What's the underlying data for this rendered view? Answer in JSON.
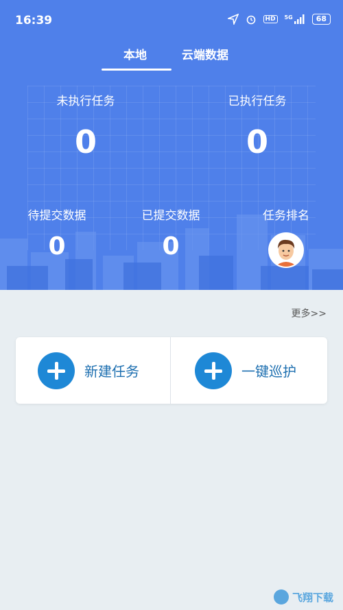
{
  "status_bar": {
    "time": "16:39",
    "battery": "68",
    "signal_label": "5G",
    "hd_label": "HD"
  },
  "tabs": [
    {
      "label": "本地",
      "active": true
    },
    {
      "label": "云端数据",
      "active": false
    }
  ],
  "stats": {
    "unexecuted": {
      "label": "未执行任务",
      "value": "0"
    },
    "executed": {
      "label": "已执行任务",
      "value": "0"
    },
    "pending_submit": {
      "label": "待提交数据",
      "value": "0"
    },
    "submitted": {
      "label": "已提交数据",
      "value": "0"
    },
    "ranking": {
      "label": "任务排名"
    }
  },
  "more_link": "更多>>",
  "actions": {
    "new_task": "新建任务",
    "one_click_patrol": "一键巡护"
  },
  "watermark": "飞翔下载",
  "colors": {
    "header_bg": "#4f80ea",
    "accent": "#1e88d6",
    "page_bg": "#e8eef2"
  }
}
